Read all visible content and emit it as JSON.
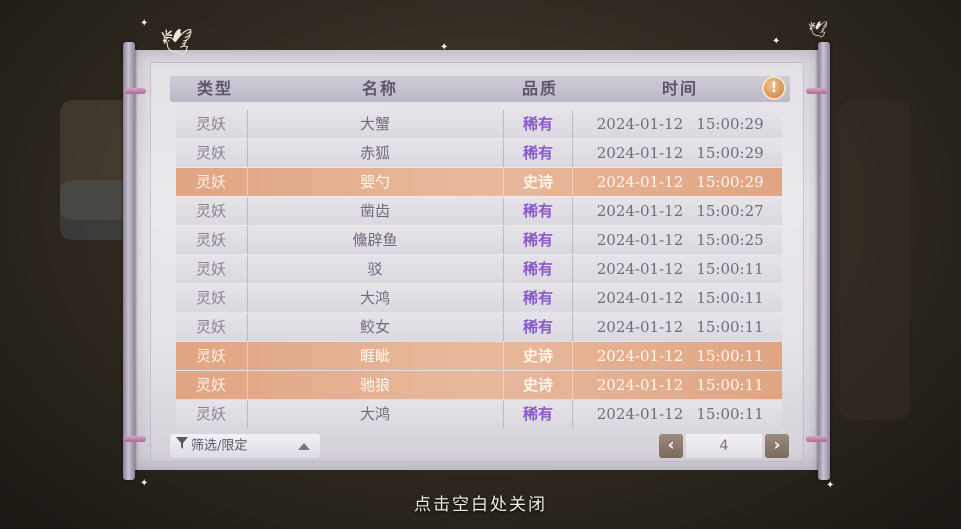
{
  "table": {
    "headers": {
      "type": "类型",
      "name": "名称",
      "quality": "品质",
      "time": "时间"
    },
    "info_icon": "!",
    "rows": [
      {
        "type": "灵妖",
        "name": "大蟹",
        "quality": "稀有",
        "date": "2024-01-12",
        "clock": "15:00:29",
        "epic": false
      },
      {
        "type": "灵妖",
        "name": "赤狐",
        "quality": "稀有",
        "date": "2024-01-12",
        "clock": "15:00:29",
        "epic": false
      },
      {
        "type": "灵妖",
        "name": "婴勺",
        "quality": "史诗",
        "date": "2024-01-12",
        "clock": "15:00:29",
        "epic": true
      },
      {
        "type": "灵妖",
        "name": "凿齿",
        "quality": "稀有",
        "date": "2024-01-12",
        "clock": "15:00:27",
        "epic": false
      },
      {
        "type": "灵妖",
        "name": "儵辟鱼",
        "quality": "稀有",
        "date": "2024-01-12",
        "clock": "15:00:25",
        "epic": false
      },
      {
        "type": "灵妖",
        "name": "驳",
        "quality": "稀有",
        "date": "2024-01-12",
        "clock": "15:00:11",
        "epic": false
      },
      {
        "type": "灵妖",
        "name": "大鸿",
        "quality": "稀有",
        "date": "2024-01-12",
        "clock": "15:00:11",
        "epic": false
      },
      {
        "type": "灵妖",
        "name": "鲛女",
        "quality": "稀有",
        "date": "2024-01-12",
        "clock": "15:00:11",
        "epic": false
      },
      {
        "type": "灵妖",
        "name": "睚眦",
        "quality": "史诗",
        "date": "2024-01-12",
        "clock": "15:00:11",
        "epic": true
      },
      {
        "type": "灵妖",
        "name": "驰狼",
        "quality": "史诗",
        "date": "2024-01-12",
        "clock": "15:00:11",
        "epic": true
      },
      {
        "type": "灵妖",
        "name": "大鸿",
        "quality": "稀有",
        "date": "2024-01-12",
        "clock": "15:00:11",
        "epic": false
      }
    ]
  },
  "filter": {
    "label": "筛选/限定",
    "icon": "filter-icon"
  },
  "pagination": {
    "prev": "‹",
    "page": "4",
    "next": "›"
  },
  "close_hint": "点击空白处关闭",
  "colors": {
    "rare": "#8a5ac9",
    "epic_row": "#e0a583"
  }
}
